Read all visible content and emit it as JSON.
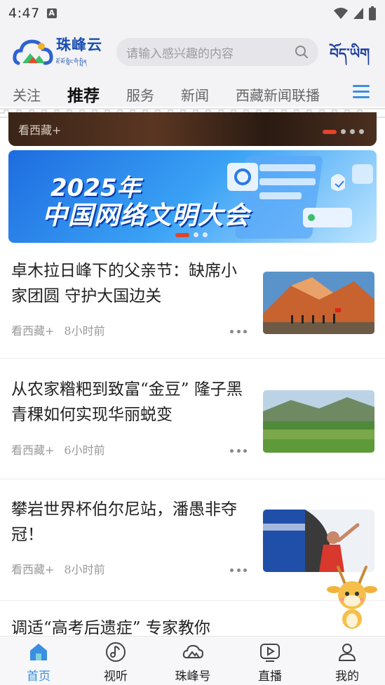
{
  "status_bar": {
    "time": "4:47",
    "indicator": "A"
  },
  "header": {
    "logo_title": "珠峰云",
    "logo_subtitle": "ཇོ་མོ་གླིང་གི་སྤྲིན",
    "search_placeholder": "请输入感兴趣的内容",
    "tibetan_button": "བོད་ཡིག"
  },
  "tabs": [
    {
      "label": "关注",
      "active": false
    },
    {
      "label": "推荐",
      "active": true
    },
    {
      "label": "服务",
      "active": false
    },
    {
      "label": "新闻",
      "active": false
    },
    {
      "label": "西藏新闻联播",
      "active": false
    }
  ],
  "banner_top": {
    "source": "看西藏+",
    "page_index": 1,
    "page_count": 4
  },
  "banner_main": {
    "year_text": "2025年",
    "title": "中国网络文明大会",
    "page_index": 1,
    "page_count": 3
  },
  "articles": [
    {
      "title": "卓木拉日峰下的父亲节：缺席小家团圆 守护大国边关",
      "source": "看西藏+",
      "time": "8小时前",
      "thumbnail": "mountain-soldiers"
    },
    {
      "title": "从农家糌粑到致富“金豆” 隆子黑青稞如何实现华丽蜕变",
      "source": "看西藏+",
      "time": "6小时前",
      "thumbnail": "barley-field"
    },
    {
      "title": "攀岩世界杯伯尔尼站，潘愚非夺冠！",
      "source": "看西藏+",
      "time": "8小时前",
      "thumbnail": "climbing"
    },
    {
      "title": "调适“高考后遗症” 专家教你"
    }
  ],
  "bottom_nav": [
    {
      "label": "首页",
      "icon": "home-icon",
      "active": true
    },
    {
      "label": "视听",
      "icon": "music-note-icon",
      "active": false
    },
    {
      "label": "珠峰号",
      "icon": "cloud-mountain-icon",
      "active": false
    },
    {
      "label": "直播",
      "icon": "play-icon",
      "active": false
    },
    {
      "label": "我的",
      "icon": "user-icon",
      "active": false
    }
  ],
  "colors": {
    "accent": "#3a8fe0",
    "brand": "#1b4fb0",
    "highlight_red": "#e2432b"
  }
}
